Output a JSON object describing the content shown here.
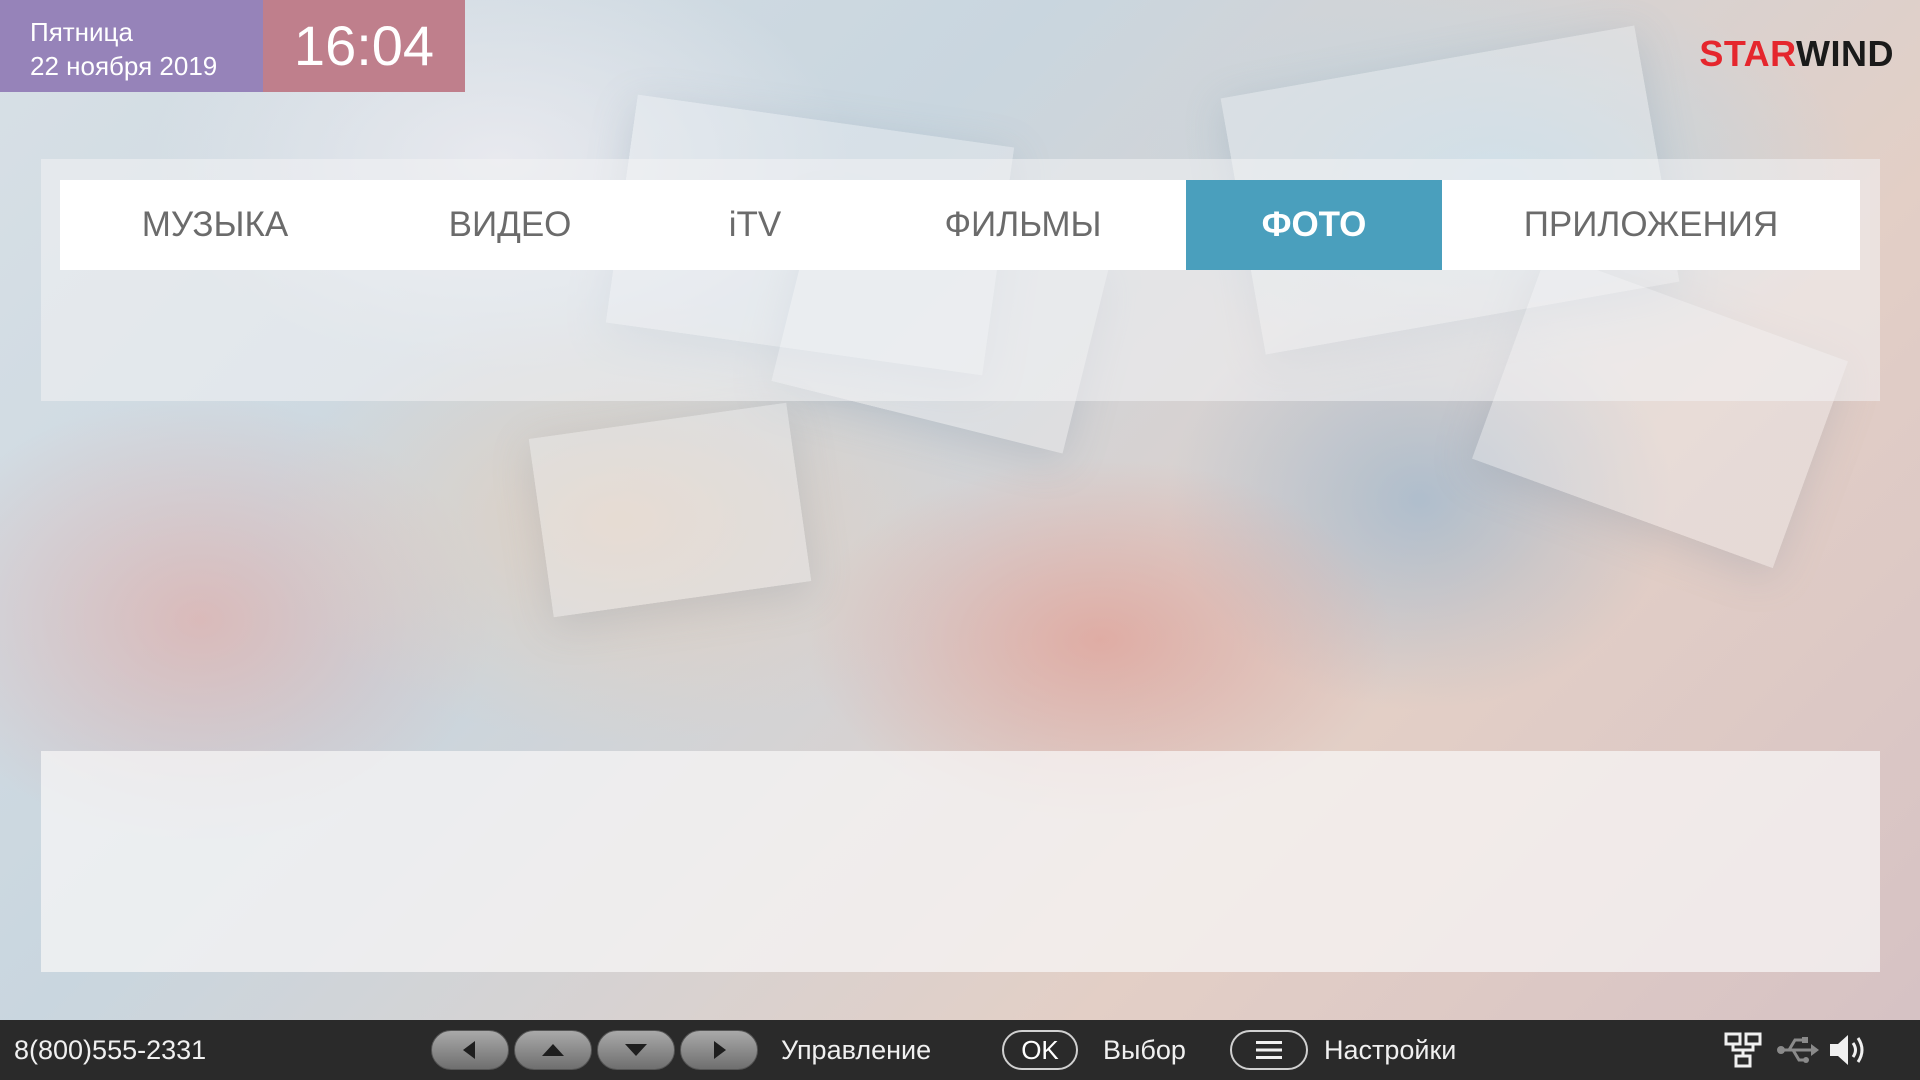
{
  "header": {
    "day": "Пятница",
    "date": "22  ноября 2019",
    "time": "16:04",
    "logo_part1": "STAR",
    "logo_part2": "WIND"
  },
  "tabs": [
    {
      "label": "МУЗЫКА",
      "active": false
    },
    {
      "label": "ВИДЕО",
      "active": false
    },
    {
      "label": "iTV",
      "active": false
    },
    {
      "label": "ФИЛЬМЫ",
      "active": false
    },
    {
      "label": "ФОТО",
      "active": true
    },
    {
      "label": "ПРИЛОЖЕНИЯ",
      "active": false
    }
  ],
  "footer": {
    "phone": "8(800)555-2331",
    "nav_label": "Управление",
    "ok_label": "OK",
    "select_label": "Выбор",
    "settings_label": "Настройки",
    "icons": [
      "left-arrow-icon",
      "up-arrow-icon",
      "down-arrow-icon",
      "right-arrow-icon",
      "menu-icon",
      "network-icon",
      "usb-icon",
      "volume-icon"
    ]
  },
  "colors": {
    "date_bg": "#9683b9",
    "time_bg": "#bf7f8c",
    "active_tab": "#4a9fbd",
    "logo_red": "#e5262d",
    "footer_bg": "#2a2a2a"
  }
}
